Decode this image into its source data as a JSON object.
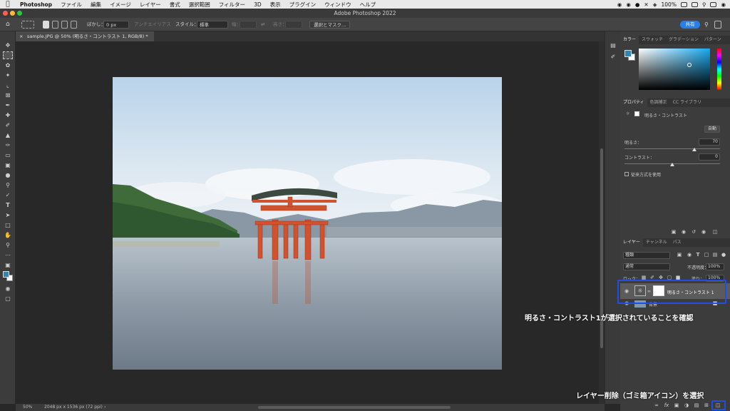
{
  "menubar": {
    "app_name": "Photoshop",
    "items": [
      "ファイル",
      "編集",
      "イメージ",
      "レイヤー",
      "書式",
      "選択範囲",
      "フィルター",
      "3D",
      "表示",
      "プラグイン",
      "ウィンドウ",
      "ヘルプ"
    ],
    "battery": "100%"
  },
  "window": {
    "title": "Adobe Photoshop 2022"
  },
  "options": {
    "feather_label": "ぼかし：",
    "feather_value": "0 px",
    "antialias_label": "アンチエイリアス",
    "style_label": "スタイル：",
    "style_value": "標準",
    "width_label": "幅：",
    "height_label": "高さ：",
    "select_mask_label": "選択とマスク...",
    "share_label": "共有"
  },
  "document": {
    "tab_label": "sample.JPG @ 50% (明るさ・コントラスト 1, RGB/8) *",
    "zoom": "50%",
    "doc_info": "2048 px x 1536 px (72 ppi)"
  },
  "color_panel": {
    "tabs": [
      "カラー",
      "スウォッチ",
      "グラデーション",
      "パターン"
    ],
    "fg_color": "#2e86b4",
    "bg_color": "#ffffff"
  },
  "properties_panel": {
    "tabs": [
      "プロパティ",
      "色調補正",
      "CC ライブラリ"
    ],
    "layer_type": "明るさ・コントラスト",
    "auto_label": "自動",
    "brightness_label": "明るさ：",
    "brightness_value": "70",
    "brightness_fraction": 0.73,
    "contrast_label": "コントラスト：",
    "contrast_value": "0",
    "contrast_fraction": 0.5,
    "legacy_label": "従来方式を使用"
  },
  "layers_panel": {
    "tabs": [
      "レイヤー",
      "チャンネル",
      "パス"
    ],
    "filter_label": "種類",
    "blend_mode": "通常",
    "opacity_label": "不透明度：",
    "opacity_value": "100%",
    "lock_label": "ロック：",
    "fill_label": "塗り：",
    "fill_value": "100%",
    "layers": [
      {
        "name": "明るさ・コントラスト 1",
        "selected": true
      },
      {
        "name": "背景",
        "selected": false
      }
    ]
  },
  "annotations": {
    "confirm_text": "明るさ・コントラスト1が選択されていることを確認",
    "delete_text": "レイヤー削除（ゴミ箱アイコン）を選択"
  },
  "colors": {
    "accent": "#1e4fe0",
    "share_button": "#2680eb",
    "torii": "#d2522e"
  }
}
